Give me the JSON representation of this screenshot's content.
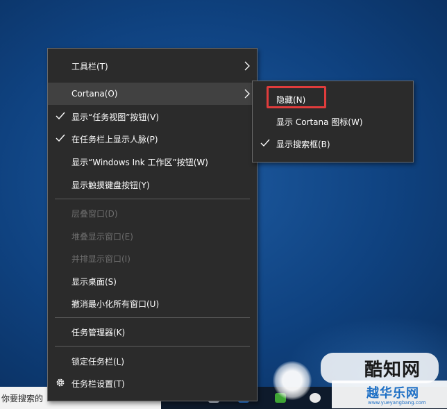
{
  "taskbar": {
    "search_placeholder": "你要搜索的"
  },
  "main_menu": {
    "items": [
      {
        "label": "工具栏(T)",
        "submenu": true
      },
      {
        "label": "Cortana(O)",
        "submenu": true,
        "hovered": true
      },
      {
        "label": "显示“任务视图”按钮(V)",
        "checked": true
      },
      {
        "label": "在任务栏上显示人脉(P)",
        "checked": true
      },
      {
        "label": "显示“Windows Ink 工作区”按钮(W)"
      },
      {
        "label": "显示触摸键盘按钮(Y)"
      },
      {
        "label": "层叠窗口(D)",
        "disabled": true
      },
      {
        "label": "堆叠显示窗口(E)",
        "disabled": true
      },
      {
        "label": "并排显示窗口(I)",
        "disabled": true
      },
      {
        "label": "显示桌面(S)"
      },
      {
        "label": "撤消最小化所有窗口(U)"
      },
      {
        "label": "任务管理器(K)"
      },
      {
        "label": "锁定任务栏(L)"
      },
      {
        "label": "任务栏设置(T)",
        "icon": "gear-icon"
      }
    ]
  },
  "cortana_submenu": {
    "items": [
      {
        "label": "隐藏(N)",
        "highlighted": true
      },
      {
        "label": "显示 Cortana 图标(W)"
      },
      {
        "label": "显示搜索框(B)",
        "checked": true
      }
    ]
  },
  "watermark": {
    "brand_text": "酷知网",
    "site_text": "越华乐网",
    "site_url": "www.yueyangbang.com"
  },
  "colors": {
    "menu_bg": "#2b2b2b",
    "menu_border": "#6b6b6b",
    "disabled_text": "#6d6d6d",
    "highlight_border": "#e03c3c",
    "desktop_bg": "#0f4280"
  }
}
